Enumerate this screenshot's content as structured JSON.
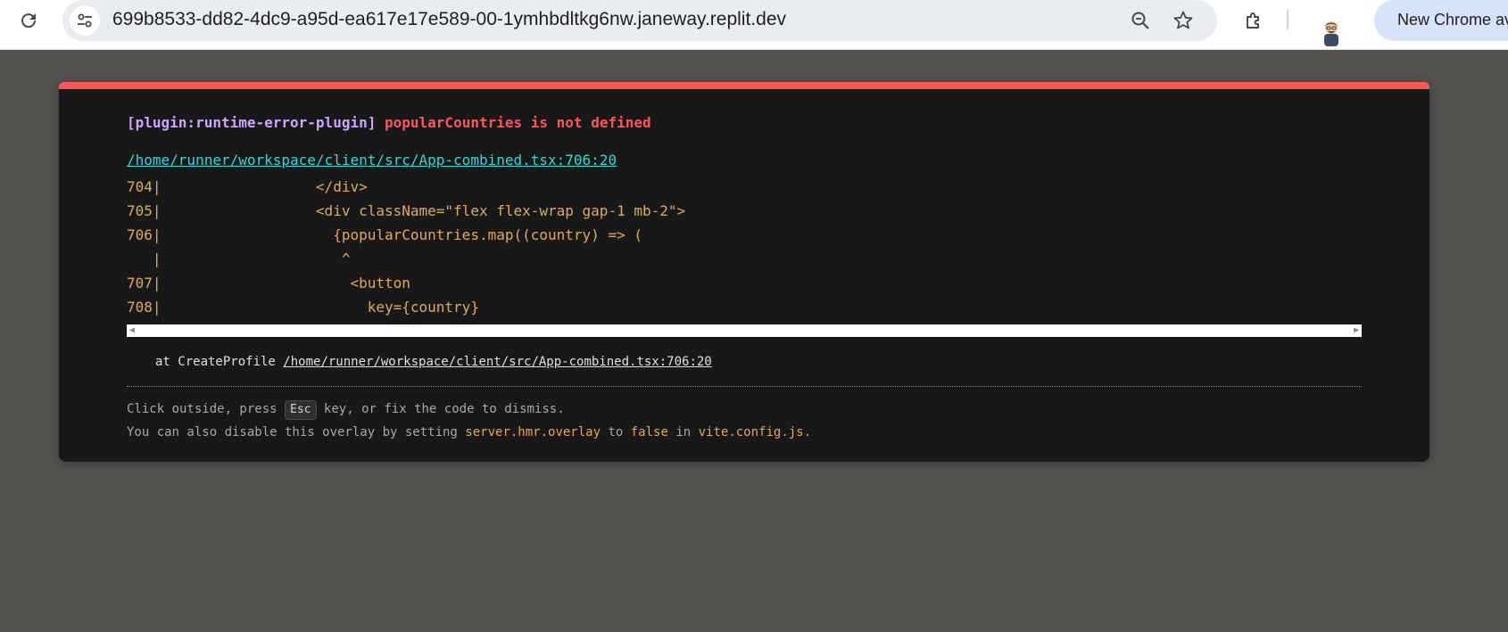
{
  "browser": {
    "url": "699b8533-dd82-4dc9-a95d-ea617e17e589-00-1ymhbdltkg6nw.janeway.replit.dev",
    "new_chrome_label": "New Chrome av",
    "icons": [
      "reload-icon",
      "site-info-icon",
      "zoom-icon",
      "bookmark-star-icon",
      "extensions-icon",
      "profile-avatar"
    ]
  },
  "overlay": {
    "plugin": "[plugin:runtime-error-plugin]",
    "message": "popularCountries is not defined",
    "file": "/home/runner/workspace/client/src/App-combined.tsx:706:20",
    "frame": [
      "704|                  </div>",
      "705|                  <div className=\"flex flex-wrap gap-1 mb-2\">",
      "706|                    {popularCountries.map((country) => (",
      "   |                     ^",
      "707|                      <button",
      "708|                        key={country}"
    ],
    "stack_prefix": "at CreateProfile ",
    "stack_link": "/home/runner/workspace/client/src/App-combined.tsx:706:20",
    "tip1": {
      "before": "Click outside, press ",
      "key": "Esc",
      "after": " key, or fix the code to dismiss."
    },
    "tip2": {
      "before": "You can also disable this overlay by setting ",
      "code1": "server.hmr.overlay",
      "mid1": " to ",
      "code2": "false",
      "mid2": " in ",
      "code3": "vite.config.js",
      "after": "."
    },
    "colors": {
      "accent": "#ff5555",
      "plugin": "#cfa4ff",
      "link": "#2dd9da",
      "code": "#e2aa53",
      "background": "#181818"
    }
  }
}
